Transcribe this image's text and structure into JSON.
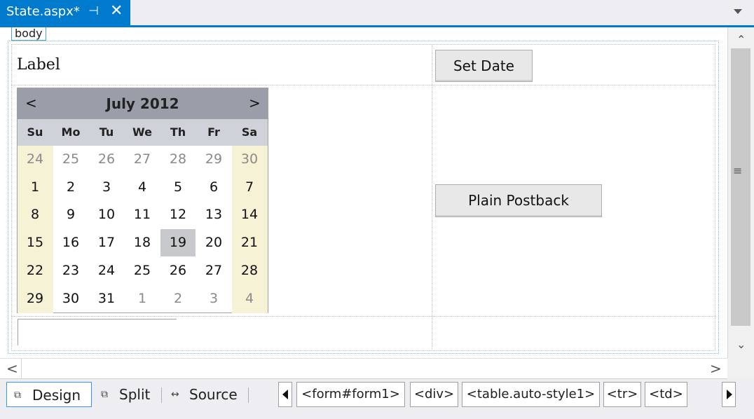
{
  "tab": {
    "title": "State.aspx*",
    "pin_glyph": "⊣",
    "close_glyph": "✕"
  },
  "designer": {
    "body_tag": "body",
    "label_text": "Label",
    "set_date_button": "Set Date",
    "plain_postback_button": "Plain Postback"
  },
  "calendar": {
    "prev": "<",
    "next": ">",
    "month": "July 2012",
    "dow": [
      "Su",
      "Mo",
      "Tu",
      "We",
      "Th",
      "Fr",
      "Sa"
    ],
    "weeks": [
      [
        {
          "d": "24",
          "other": true
        },
        {
          "d": "25",
          "other": true
        },
        {
          "d": "26",
          "other": true
        },
        {
          "d": "27",
          "other": true
        },
        {
          "d": "28",
          "other": true
        },
        {
          "d": "29",
          "other": true
        },
        {
          "d": "30",
          "other": true
        }
      ],
      [
        {
          "d": "1"
        },
        {
          "d": "2"
        },
        {
          "d": "3"
        },
        {
          "d": "4"
        },
        {
          "d": "5"
        },
        {
          "d": "6"
        },
        {
          "d": "7"
        }
      ],
      [
        {
          "d": "8"
        },
        {
          "d": "9"
        },
        {
          "d": "10"
        },
        {
          "d": "11"
        },
        {
          "d": "12"
        },
        {
          "d": "13"
        },
        {
          "d": "14"
        }
      ],
      [
        {
          "d": "15"
        },
        {
          "d": "16"
        },
        {
          "d": "17"
        },
        {
          "d": "18"
        },
        {
          "d": "19",
          "selected": true
        },
        {
          "d": "20"
        },
        {
          "d": "21"
        }
      ],
      [
        {
          "d": "22"
        },
        {
          "d": "23"
        },
        {
          "d": "24"
        },
        {
          "d": "25"
        },
        {
          "d": "26"
        },
        {
          "d": "27"
        },
        {
          "d": "28"
        }
      ],
      [
        {
          "d": "29"
        },
        {
          "d": "30"
        },
        {
          "d": "31"
        },
        {
          "d": "1",
          "other": true
        },
        {
          "d": "2",
          "other": true
        },
        {
          "d": "3",
          "other": true
        },
        {
          "d": "4",
          "other": true
        }
      ]
    ]
  },
  "scroll": {
    "up": "⌃",
    "down": "⌄",
    "grip": "≡",
    "left": "<",
    "right": ">"
  },
  "bottom": {
    "views": [
      {
        "label": "Design",
        "icon": "design-view-icon",
        "active": true
      },
      {
        "label": "Split",
        "icon": "split-view-icon",
        "active": false
      },
      {
        "label": "Source",
        "icon": "source-view-icon",
        "active": false
      }
    ],
    "breadcrumbs": [
      "<form#form1>",
      "<div>",
      "<table.auto-style1>",
      "<tr>",
      "<td>"
    ]
  },
  "colors": {
    "accent": "#007acc",
    "weekend": "#f5f2d5",
    "selected_day": "#c7c9cc",
    "calendar_header": "#999ea8"
  }
}
